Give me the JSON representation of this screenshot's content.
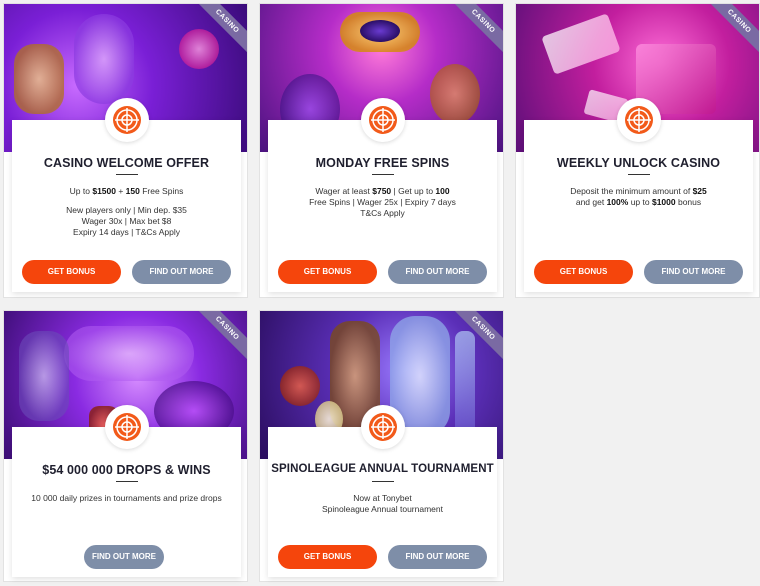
{
  "badge": "CASINO",
  "buttons": {
    "bonus": "GET BONUS",
    "more": "FIND OUT MORE"
  },
  "colors": {
    "accent": "#f5450c",
    "secondary_button": "#7e8ea8",
    "ribbon": "#7a6aa3"
  },
  "cards": [
    {
      "title": "CASINO WELCOME OFFER",
      "desc": [
        [
          "Up to ",
          "$1500",
          " + ",
          "150",
          " Free Spins"
        ],
        [],
        [
          "New players only | Min dep. $35"
        ],
        [
          "Wager 30x | Max bet $8"
        ],
        [
          "Expiry 14 days | T&Cs Apply"
        ]
      ]
    },
    {
      "title": "MONDAY FREE SPINS",
      "desc": [
        [
          "Wager at least ",
          "$750",
          " | Get up to ",
          "100"
        ],
        [
          "Free Spins | Wager 25x | Expiry 7 days"
        ],
        [
          "T&Cs Apply"
        ]
      ]
    },
    {
      "title": "WEEKLY UNLOCK CASINO",
      "desc": [
        [
          "Deposit the minimum amount of ",
          "$25"
        ],
        [
          "and get ",
          "100%",
          " up to ",
          "$1000",
          " bonus"
        ]
      ]
    },
    {
      "title": "$54 000 000 DROPS & WINS",
      "desc": [
        [
          "10 000 daily prizes in tournaments and prize drops"
        ]
      ]
    },
    {
      "title": "SPINOLEAGUE ANNUAL TOURNAMENT",
      "desc": [
        [
          "Now at Tonybet"
        ],
        [
          "Spinoleague Annual tournament"
        ]
      ]
    }
  ]
}
